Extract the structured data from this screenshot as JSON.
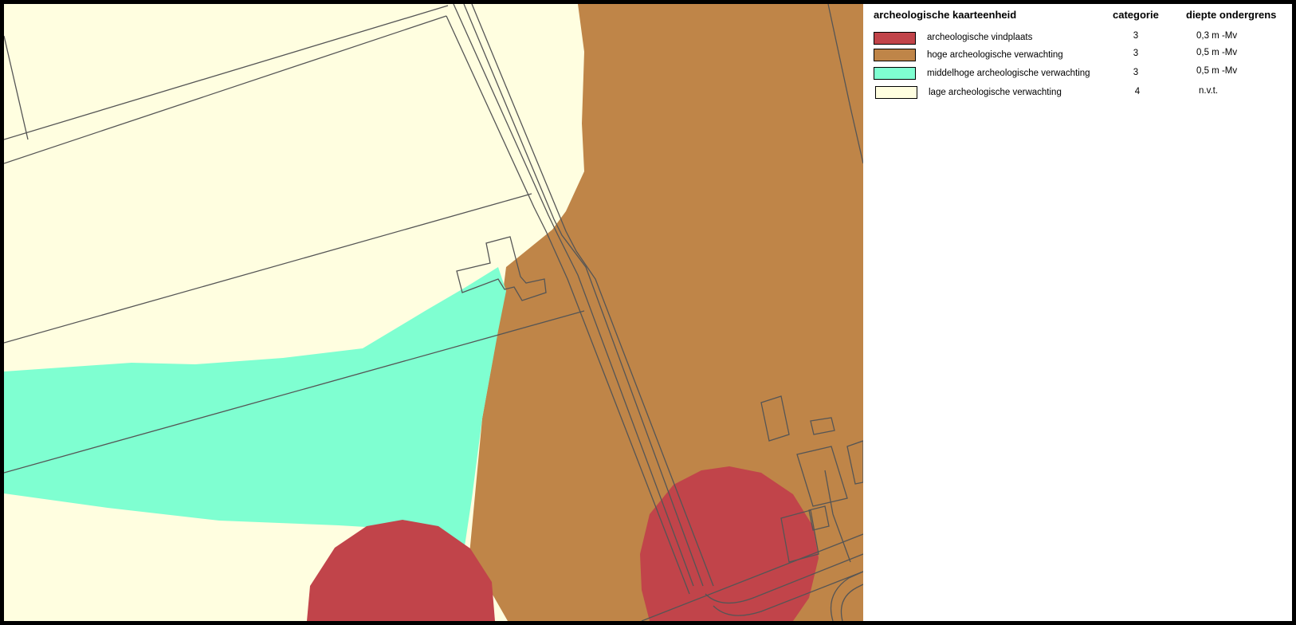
{
  "legend": {
    "headers": {
      "unit": "archeologische kaarteenheid",
      "category": "categorie",
      "depth": "diepte ondergrens"
    },
    "items": [
      {
        "label": "archeologische vindplaats",
        "category": "3",
        "depth": "0,3 m -Mv",
        "color": "#c1444a"
      },
      {
        "label": "hoge archeologische verwachting",
        "category": "3",
        "depth": "0,5 m -Mv",
        "color": "#bf8548"
      },
      {
        "label": "middelhoge archeologische verwachting",
        "category": "3",
        "depth": "0,5 m -Mv",
        "color": "#7fffd1"
      },
      {
        "label": "lage archeologische verwachting",
        "category": "4",
        "depth": "n.v.t.",
        "color": "#fffee0"
      }
    ]
  },
  "map": {
    "line_color": "#555555"
  }
}
